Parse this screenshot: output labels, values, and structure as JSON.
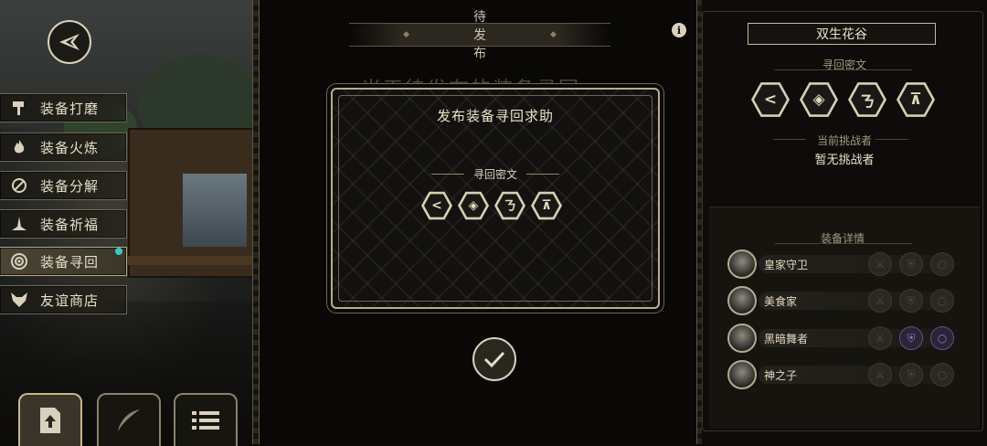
{
  "side_menu": {
    "items": [
      {
        "label": "装备打磨",
        "icon": "hammer-icon"
      },
      {
        "label": "装备火炼",
        "icon": "flame-icon"
      },
      {
        "label": "装备分解",
        "icon": "scatter-icon"
      },
      {
        "label": "装备祈福",
        "icon": "pray-icon"
      },
      {
        "label": "装备寻回",
        "icon": "target-icon",
        "active": true
      },
      {
        "label": "友谊商店",
        "icon": "fox-icon"
      }
    ]
  },
  "bottom_tabs": [
    {
      "icon": "upload-icon",
      "active": true
    },
    {
      "icon": "feather-icon",
      "active": false
    },
    {
      "icon": "list-icon",
      "active": false
    }
  ],
  "main": {
    "tab_label": "待发布",
    "background_text": "当天待发布的装备寻回"
  },
  "modal": {
    "title": "发布装备寻回求助",
    "subtitle": "寻回密文",
    "glyphs": [
      "<",
      "◈",
      "ㄋ",
      "⊼"
    ]
  },
  "right_panel": {
    "title": "双生花谷",
    "cipher_label": "寻回密文",
    "glyphs": [
      "<",
      "◈",
      "ㄋ",
      "⊼"
    ],
    "challenger_label": "当前挑战者",
    "challenger_value": "暂无挑战者",
    "equip_label": "装备详情",
    "equip_rows": [
      {
        "name": "皇家守卫"
      },
      {
        "name": "美食家"
      },
      {
        "name": "黑暗舞者",
        "lit": true
      },
      {
        "name": "神之子"
      }
    ]
  },
  "colors": {
    "accent": "#d9d1bd",
    "background": "#0c0b09",
    "highlight_purple": "#8b79c9"
  }
}
